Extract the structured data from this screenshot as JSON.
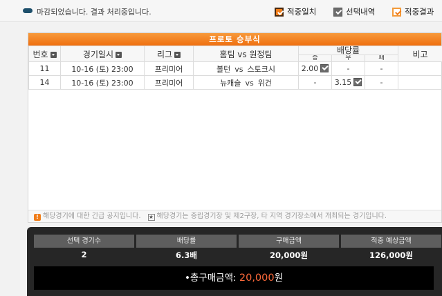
{
  "status": {
    "text": "마감되었습니다. 결과 처리중입니다."
  },
  "legend": [
    {
      "label": "적중일치",
      "icon": "orange-checked-box-icon"
    },
    {
      "label": "선택내역",
      "icon": "gray-checked-box-icon"
    },
    {
      "label": "적중결과",
      "icon": "orange-outline-checked-box-icon"
    }
  ],
  "panel": {
    "title": "프로토 승부식",
    "headers": {
      "no": "번호",
      "date": "경기일시",
      "league": "리그",
      "match": "홈팀 vs 원정팀",
      "odds": "배당률",
      "win": "승",
      "draw": "무",
      "lose": "패",
      "note": "비고"
    },
    "rows": [
      {
        "no": "11",
        "date": "10-16 (토) 23:00",
        "league": "프리미어",
        "home": "볼턴",
        "vs": "vs",
        "away": "스토크시",
        "win": "2.00",
        "draw": "-",
        "lose": "-",
        "note": ""
      },
      {
        "no": "14",
        "date": "10-16 (토) 23:00",
        "league": "프리미어",
        "home": "뉴캐슬",
        "vs": "vs",
        "away": "위건",
        "win": "-",
        "draw": "3.15",
        "lose": "-",
        "note": ""
      }
    ],
    "notice": {
      "urgent": "해당경기에 대한 긴급 공지입니다.",
      "venue": "해당경기는 중립경기장 및 제2구장, 타 지역 경기장소에서 개최되는 경기입니다."
    }
  },
  "summary": {
    "headers": [
      "선택 경기수",
      "배당률",
      "구매금액",
      "적중 예상금액"
    ],
    "values": [
      "2",
      "6.3배",
      "20,000원",
      "126,000원"
    ],
    "total_label": "총구매금액:",
    "total_amount": "20,000",
    "total_unit": "원"
  },
  "colors": {
    "accent": "#ef6f0f",
    "total_amount": "#ff6a3a",
    "summary_bg": "#262626"
  }
}
